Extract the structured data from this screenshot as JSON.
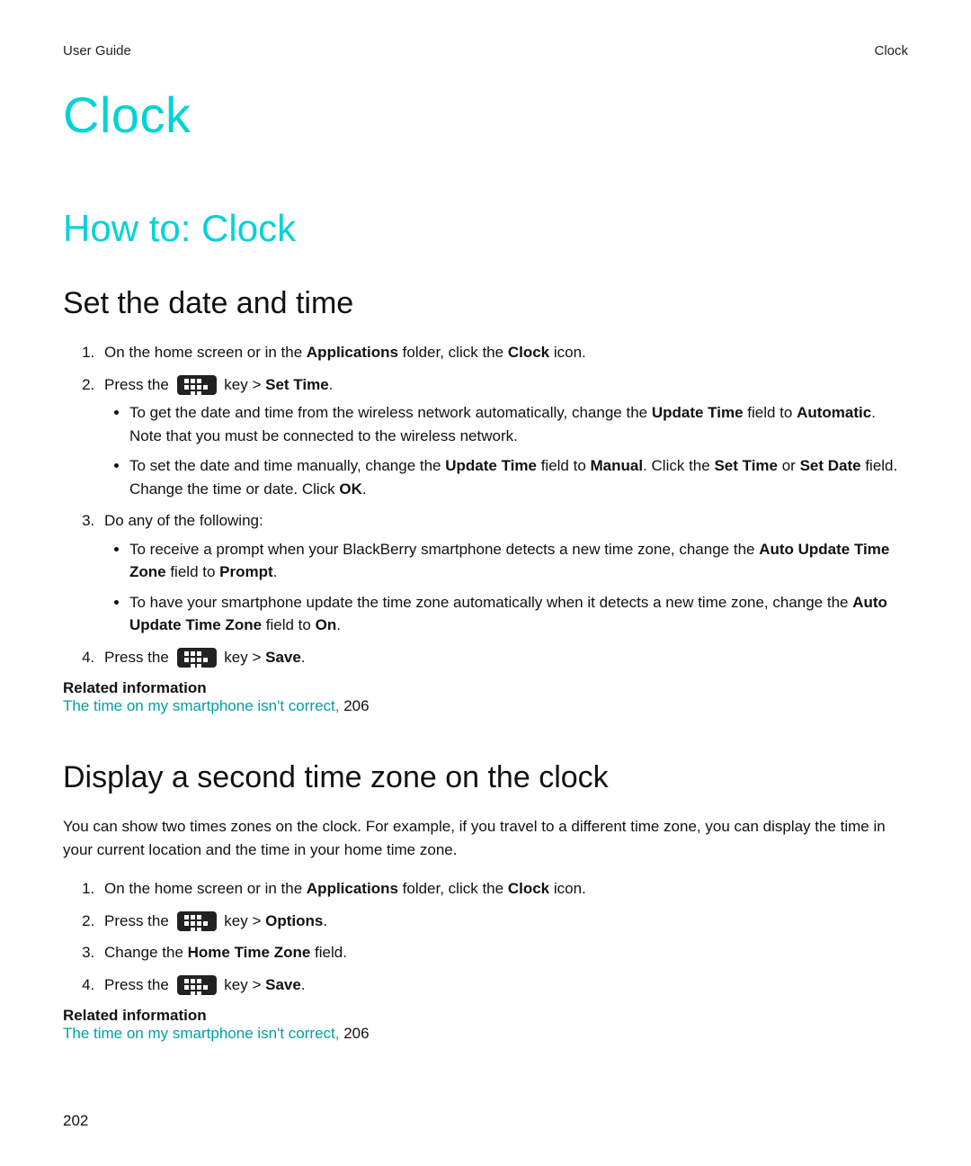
{
  "header": {
    "left": "User Guide",
    "right": "Clock"
  },
  "chapter_title": "Clock",
  "section_title": "How to: Clock",
  "s1": {
    "title": "Set the date and time",
    "step1_a": "On the home screen or in the ",
    "step1_b": "Applications",
    "step1_c": " folder, click the ",
    "step1_d": "Clock",
    "step1_e": " icon.",
    "step2_a": "Press the ",
    "step2_b": " key > ",
    "step2_c": "Set Time",
    "step2_d": ".",
    "b1_a": "To get the date and time from the wireless network automatically, change the ",
    "b1_b": "Update Time",
    "b1_c": " field to ",
    "b1_d": "Automatic",
    "b1_e": ". Note that you must be connected to the wireless network.",
    "b2_a": "To set the date and time manually, change the ",
    "b2_b": "Update Time",
    "b2_c": " field to ",
    "b2_d": "Manual",
    "b2_e": ". Click the ",
    "b2_f": "Set Time",
    "b2_g": " or ",
    "b2_h": "Set Date",
    "b2_i": " field. Change the time or date. Click ",
    "b2_j": "OK",
    "b2_k": ".",
    "step3": "Do any of the following:",
    "b3_a": "To receive a prompt when your BlackBerry smartphone detects a new time zone, change the ",
    "b3_b": "Auto Update Time Zone",
    "b3_c": " field to ",
    "b3_d": "Prompt",
    "b3_e": ".",
    "b4_a": "To have your smartphone update the time zone automatically when it detects a new time zone, change the ",
    "b4_b": "Auto Update Time Zone",
    "b4_c": " field to ",
    "b4_d": "On",
    "b4_e": ".",
    "step4_a": "Press the ",
    "step4_b": " key > ",
    "step4_c": "Save",
    "step4_d": ".",
    "related_heading": "Related information",
    "related_link": "The time on my smartphone isn't correct, ",
    "related_page": "206"
  },
  "s2": {
    "title": "Display a second time zone on the clock",
    "intro": "You can show two times zones on the clock. For example, if you travel to a different time zone, you can display the time in your current location and the time in your home time zone.",
    "step1_a": "On the home screen or in the ",
    "step1_b": "Applications",
    "step1_c": " folder, click the ",
    "step1_d": "Clock",
    "step1_e": " icon.",
    "step2_a": "Press the ",
    "step2_b": " key > ",
    "step2_c": "Options",
    "step2_d": ".",
    "step3_a": "Change the ",
    "step3_b": "Home Time Zone",
    "step3_c": " field.",
    "step4_a": "Press the ",
    "step4_b": " key > ",
    "step4_c": "Save",
    "step4_d": ".",
    "related_heading": "Related information",
    "related_link": "The time on my smartphone isn't correct, ",
    "related_page": "206"
  },
  "page_number": "202"
}
